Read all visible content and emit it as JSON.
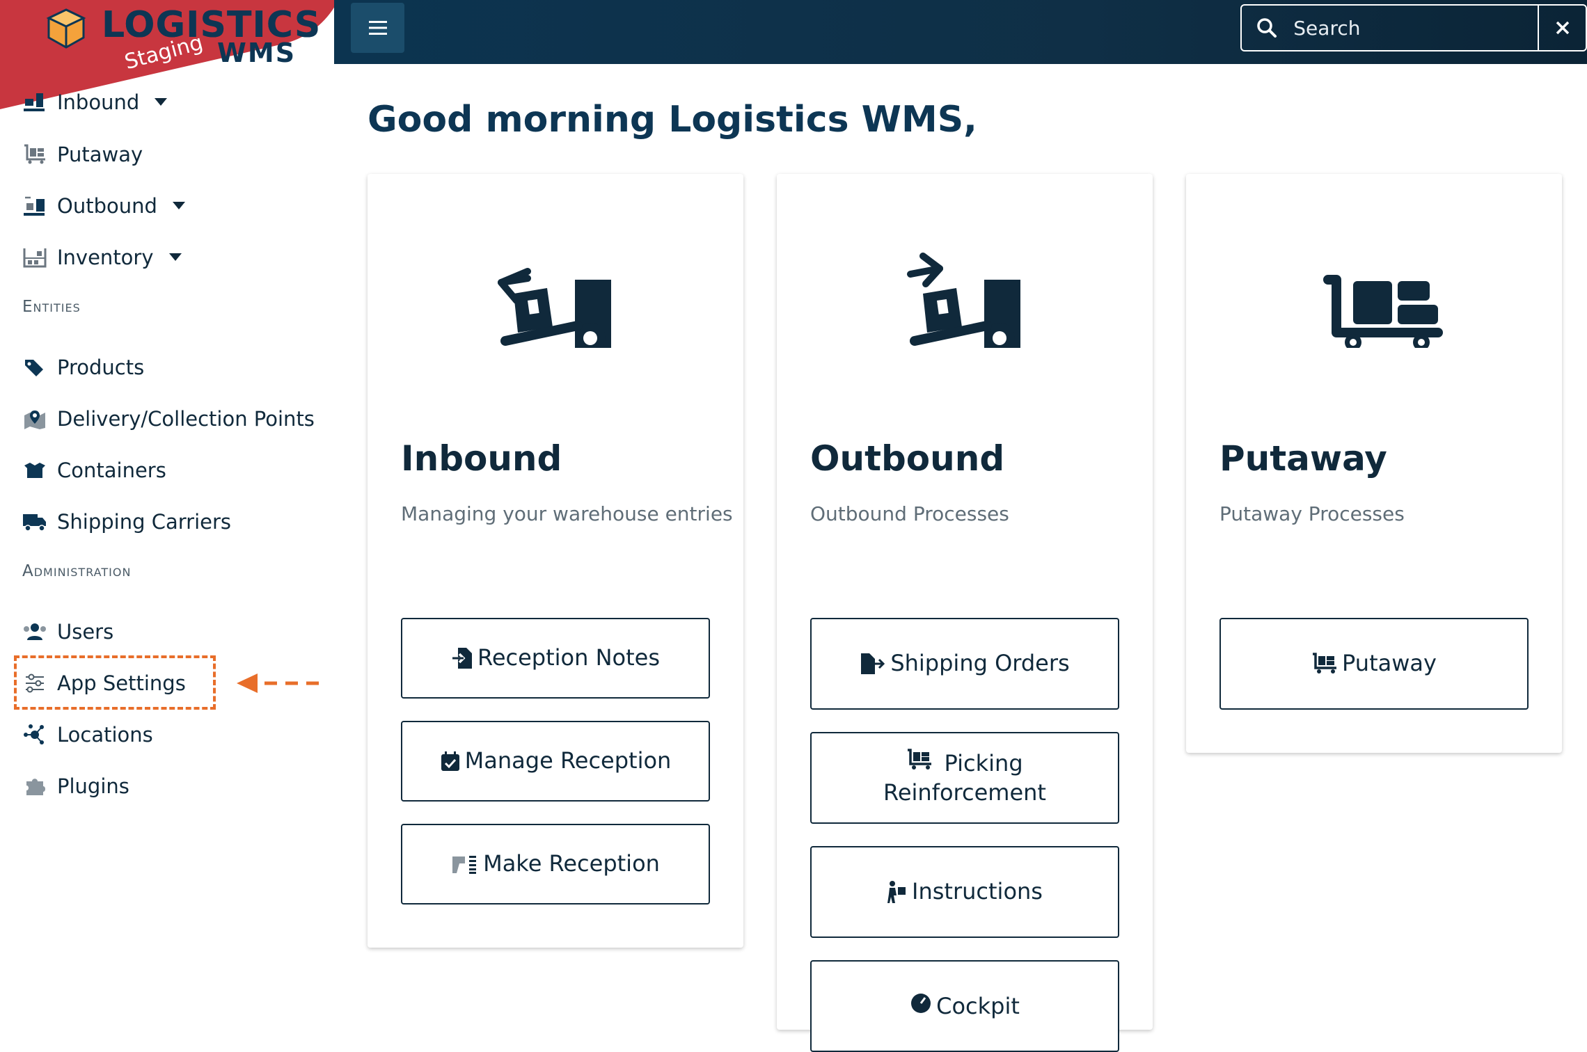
{
  "logo": {
    "title": "LOGISTICS",
    "subtitle": "WMS",
    "env_badge": "Staging"
  },
  "topbar": {
    "search_placeholder": "Search"
  },
  "nav": {
    "items": [
      {
        "label": "Inbound",
        "icon": "inbound-icon",
        "has_caret": true
      },
      {
        "label": "Putaway",
        "icon": "putaway-icon",
        "has_caret": false
      },
      {
        "label": "Outbound",
        "icon": "outbound-icon",
        "has_caret": true
      },
      {
        "label": "Inventory",
        "icon": "inventory-icon",
        "has_caret": true
      }
    ],
    "entities_label": "Entities",
    "entities": [
      {
        "label": "Products",
        "icon": "tags-icon"
      },
      {
        "label": "Delivery/Collection Points",
        "icon": "map-marker-icon"
      },
      {
        "label": "Containers",
        "icon": "box-open-icon"
      },
      {
        "label": "Shipping Carriers",
        "icon": "truck-icon"
      }
    ],
    "administration_label": "Administration",
    "administration": [
      {
        "label": "Users",
        "icon": "users-icon"
      },
      {
        "label": "App Settings",
        "icon": "sliders-icon"
      },
      {
        "label": "Locations",
        "icon": "network-icon"
      },
      {
        "label": "Plugins",
        "icon": "puzzle-icon"
      }
    ]
  },
  "main": {
    "greeting": "Good morning Logistics WMS,",
    "cards": [
      {
        "title": "Inbound",
        "subtitle": "Managing your warehouse entries",
        "buttons": [
          "Reception Notes",
          "Manage Reception",
          "Make Reception"
        ]
      },
      {
        "title": "Outbound",
        "subtitle": "Outbound Processes",
        "buttons": [
          "Shipping Orders",
          "Picking Reinforcement",
          "Instructions",
          "Cockpit"
        ]
      },
      {
        "title": "Putaway",
        "subtitle": "Putaway Processes",
        "buttons": [
          "Putaway"
        ]
      }
    ]
  },
  "colors": {
    "navy": "#10293b",
    "topbar": "#0c3450",
    "logo_band": "#c8363f",
    "highlight": "#e86e2a"
  }
}
